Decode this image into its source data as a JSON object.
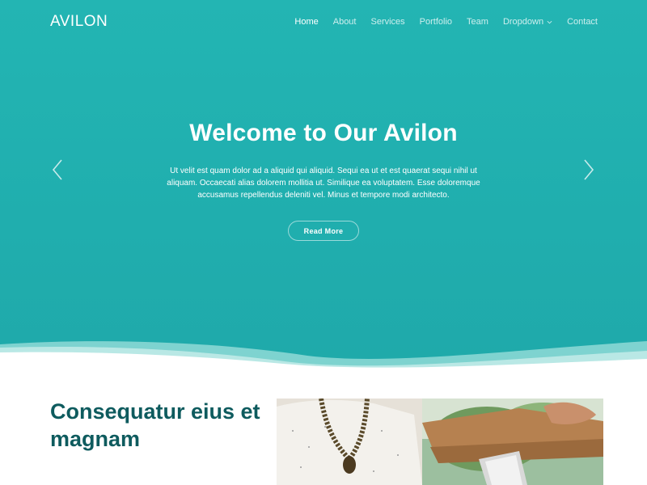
{
  "header": {
    "logo": "AVILON",
    "nav": [
      {
        "label": "Home",
        "active": true
      },
      {
        "label": "About"
      },
      {
        "label": "Services"
      },
      {
        "label": "Portfolio"
      },
      {
        "label": "Team"
      },
      {
        "label": "Dropdown",
        "has_submenu": true
      },
      {
        "label": "Contact"
      }
    ]
  },
  "hero": {
    "title": "Welcome to Our Avilon",
    "text": "Ut velit est quam dolor ad a aliquid qui aliquid. Sequi ea ut et est quaerat sequi nihil ut aliquam. Occaecati alias dolorem mollitia ut. Similique ea voluptatem. Esse doloremque accusamus repellendus deleniti vel. Minus et tempore modi architecto.",
    "button": "Read More",
    "prev_icon": "chevron-left-icon",
    "next_icon": "chevron-right-icon"
  },
  "about": {
    "title": "Consequatur eius et magnam"
  },
  "colors": {
    "hero_bg": "#21b0b0",
    "title_dark": "#0e5b5e",
    "white": "#ffffff"
  }
}
